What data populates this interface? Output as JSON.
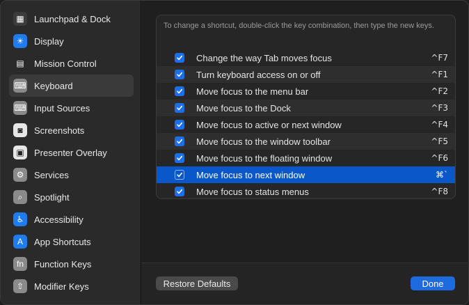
{
  "sidebar": {
    "items": [
      {
        "label": "Launchpad & Dock",
        "icon": "launchpad-icon",
        "color": "#3b3b3b",
        "glyph": "▦"
      },
      {
        "label": "Display",
        "icon": "display-icon",
        "color": "#1e7bf0",
        "glyph": "☀"
      },
      {
        "label": "Mission Control",
        "icon": "mission-control-icon",
        "color": "#2a2a2a",
        "glyph": "▤"
      },
      {
        "label": "Keyboard",
        "icon": "keyboard-icon",
        "color": "#8a8a8a",
        "glyph": "⌨"
      },
      {
        "label": "Input Sources",
        "icon": "input-sources-icon",
        "color": "#8a8a8a",
        "glyph": "⌨"
      },
      {
        "label": "Screenshots",
        "icon": "screenshots-icon",
        "color": "#e6e6e6",
        "glyph": "◙"
      },
      {
        "label": "Presenter Overlay",
        "icon": "presenter-overlay-icon",
        "color": "#e6e6e6",
        "glyph": "▣"
      },
      {
        "label": "Services",
        "icon": "services-icon",
        "color": "#8a8a8a",
        "glyph": "⚙"
      },
      {
        "label": "Spotlight",
        "icon": "spotlight-icon",
        "color": "#8a8a8a",
        "glyph": "⌕"
      },
      {
        "label": "Accessibility",
        "icon": "accessibility-icon",
        "color": "#1e7bf0",
        "glyph": "♿"
      },
      {
        "label": "App Shortcuts",
        "icon": "app-shortcuts-icon",
        "color": "#1e7bf0",
        "glyph": "A"
      },
      {
        "label": "Function Keys",
        "icon": "function-keys-icon",
        "color": "#8a8a8a",
        "glyph": "fn"
      },
      {
        "label": "Modifier Keys",
        "icon": "modifier-keys-icon",
        "color": "#8a8a8a",
        "glyph": "⇧"
      }
    ],
    "active_index": 3
  },
  "panel": {
    "hint": "To change a shortcut, double-click the key combination, then type the new keys.",
    "rows": [
      {
        "label": "Change the way Tab moves focus",
        "key": "^F7",
        "checked": true
      },
      {
        "label": "Turn keyboard access on or off",
        "key": "^F1",
        "checked": true
      },
      {
        "label": "Move focus to the menu bar",
        "key": "^F2",
        "checked": true
      },
      {
        "label": "Move focus to the Dock",
        "key": "^F3",
        "checked": true
      },
      {
        "label": "Move focus to active or next window",
        "key": "^F4",
        "checked": true
      },
      {
        "label": "Move focus to the window toolbar",
        "key": "^F5",
        "checked": true
      },
      {
        "label": "Move focus to the floating window",
        "key": "^F6",
        "checked": true
      },
      {
        "label": "Move focus to next window",
        "key": "⌘`",
        "checked": true
      },
      {
        "label": "Move focus to status menus",
        "key": "^F8",
        "checked": true
      }
    ],
    "selected_index": 7
  },
  "footer": {
    "restore_label": "Restore Defaults",
    "done_label": "Done"
  },
  "colors": {
    "accent": "#1e6be0",
    "selection": "#0a57c9"
  }
}
